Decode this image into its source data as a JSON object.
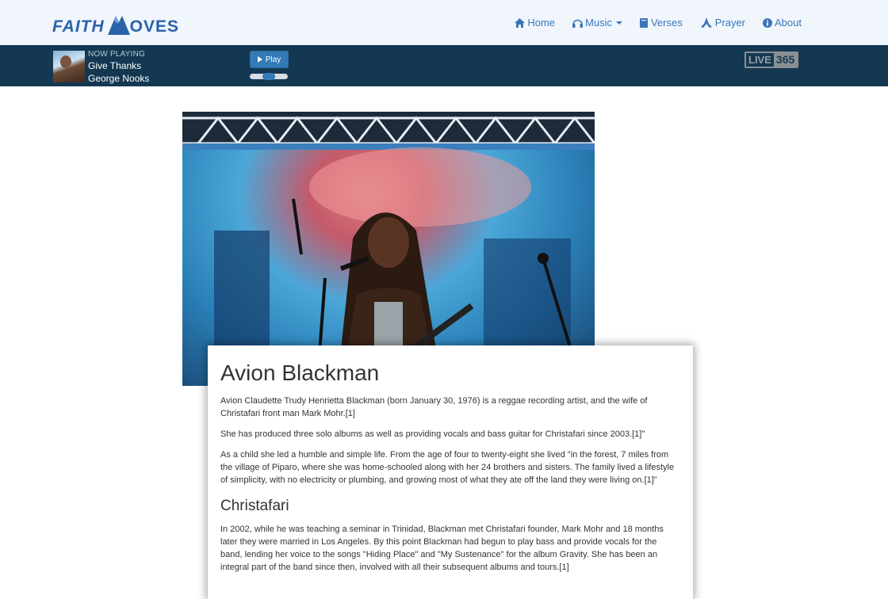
{
  "logo": {
    "part1": "Faith",
    "part2": "oves"
  },
  "nav": {
    "items": [
      {
        "label": "Home",
        "icon": "home-icon"
      },
      {
        "label": "Music",
        "icon": "headphones-icon",
        "dropdown": true
      },
      {
        "label": "Verses",
        "icon": "book-icon"
      },
      {
        "label": "Prayer",
        "icon": "praying-hands-icon"
      },
      {
        "label": "About",
        "icon": "info-icon"
      }
    ]
  },
  "player": {
    "now_playing_label": "NOW PLAYING",
    "song": "Give Thanks",
    "artist": "George Nooks",
    "play_label": "Play",
    "volume": 0.5,
    "brand_left": "LIVE",
    "brand_right": "365"
  },
  "article": {
    "title": "Avion Blackman",
    "paragraphs": [
      "Avion Claudette Trudy Henrietta Blackman (born January 30, 1976) is a reggae recording artist, and the wife of Christafari front man Mark Mohr.[1]",
      "She has produced three solo albums as well as providing vocals and bass guitar for Christafari since 2003.[1]\"",
      "As a child she led a humble and simple life. From the age of four to twenty-eight she lived \"in the forest, 7 miles from the village of Piparo, where she was home-schooled along with her 24 brothers and sisters. The family lived a lifestyle of simplicity, with no electricity or plumbing, and growing most of what they ate off the land they were living on.[1]\""
    ],
    "section_title": "Christafari",
    "section_paragraphs": [
      "In 2002, while he was teaching a seminar in Trinidad, Blackman met Christafari founder, Mark Mohr and 18 months later they were married in Los Angeles. By this point Blackman had begun to play bass and provide vocals for the band, lending her voice to the songs \"Hiding Place\" and \"My Sustenance\" for the album Gravity. She has been an integral part of the band since then, involved with all their subsequent albums and tours.[1]"
    ]
  },
  "colors": {
    "brand": "#2a62a8",
    "player_bg": "#143852",
    "nav_bg": "#f0f6fc",
    "link": "#3a76b8"
  }
}
